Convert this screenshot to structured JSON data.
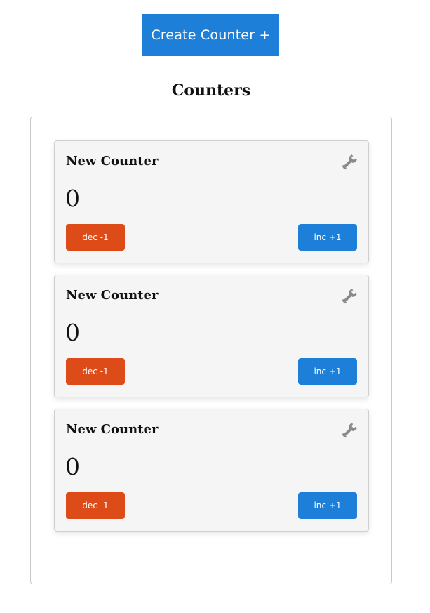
{
  "create_button": {
    "label": "Create Counter +"
  },
  "heading": "Counters",
  "counters": [
    {
      "title": "New Counter",
      "value": "0",
      "dec_label": "dec -1",
      "inc_label": "inc +1",
      "settings_icon": "wrench-icon"
    },
    {
      "title": "New Counter",
      "value": "0",
      "dec_label": "dec -1",
      "inc_label": "inc +1",
      "settings_icon": "wrench-icon"
    },
    {
      "title": "New Counter",
      "value": "0",
      "dec_label": "dec -1",
      "inc_label": "inc +1",
      "settings_icon": "wrench-icon"
    }
  ],
  "colors": {
    "primary": "#1e7fd9",
    "danger": "#dd4b18",
    "card_background": "#f5f5f5",
    "icon": "#8a8a8a"
  }
}
